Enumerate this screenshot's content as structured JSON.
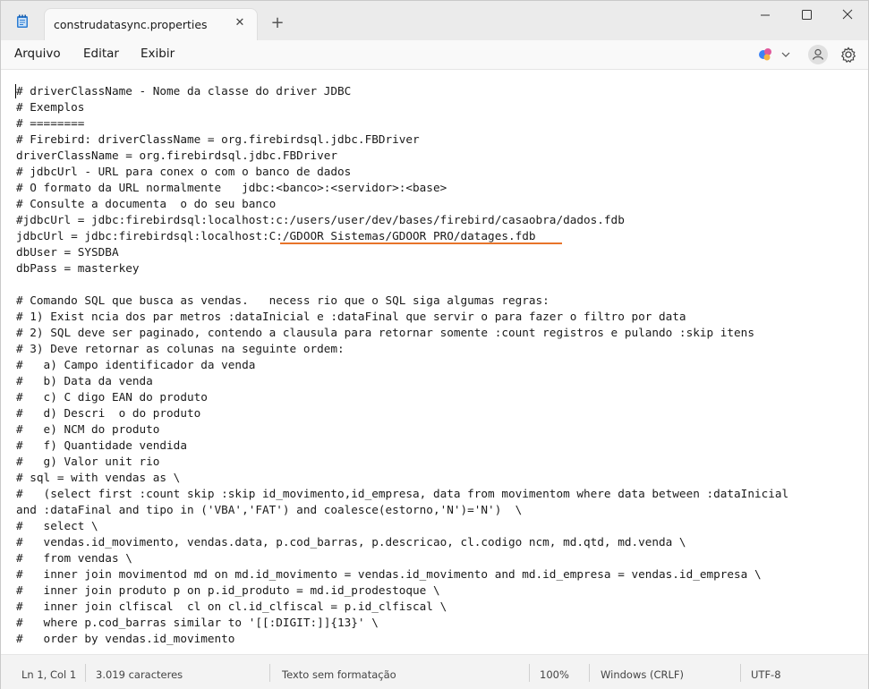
{
  "tab": {
    "title": "construdatasync.properties"
  },
  "menu": {
    "items": [
      "Arquivo",
      "Editar",
      "Exibir"
    ]
  },
  "colors": {
    "highlight": "#e8742a",
    "copilot_blue": "#3b82f6",
    "copilot_pink": "#e0589b"
  },
  "icons": {
    "app": "notepad-icon",
    "copilot": "copilot-icon",
    "profile": "person-icon",
    "settings": "gear-icon"
  },
  "editor": {
    "lines": [
      "# driverClassName - Nome da classe do driver JDBC",
      "# Exemplos",
      "# ========",
      "# Firebird: driverClassName = org.firebirdsql.jdbc.FBDriver",
      "driverClassName = org.firebirdsql.jdbc.FBDriver",
      "# jdbcUrl - URL para conex o com o banco de dados",
      "# O formato da URL normalmente   jdbc:<banco>:<servidor>:<base>",
      "# Consulte a documenta  o do seu banco",
      "#jdbcUrl = jdbc:firebirdsql:localhost:c:/users/user/dev/bases/firebird/casaobra/dados.fdb",
      "jdbcUrl = jdbc:firebirdsql:localhost:C:/GDOOR Sistemas/GDOOR PRO/datages.fdb",
      "dbUser = SYSDBA",
      "dbPass = masterkey",
      "",
      "# Comando SQL que busca as vendas.   necess rio que o SQL siga algumas regras:",
      "# 1) Exist ncia dos par metros :dataInicial e :dataFinal que servir o para fazer o filtro por data",
      "# 2) SQL deve ser paginado, contendo a clausula para retornar somente :count registros e pulando :skip itens",
      "# 3) Deve retornar as colunas na seguinte ordem:",
      "#   a) Campo identificador da venda",
      "#   b) Data da venda",
      "#   c) C digo EAN do produto",
      "#   d) Descri  o do produto",
      "#   e) NCM do produto",
      "#   f) Quantidade vendida",
      "#   g) Valor unit rio",
      "# sql = with vendas as \\",
      "#   (select first :count skip :skip id_movimento,id_empresa, data from movimentom where data between :dataInicial",
      "and :dataFinal and tipo in ('VBA','FAT') and coalesce(estorno,'N')='N')  \\",
      "#   select \\",
      "#   vendas.id_movimento, vendas.data, p.cod_barras, p.descricao, cl.codigo ncm, md.qtd, md.venda \\",
      "#   from vendas \\",
      "#   inner join movimentod md on md.id_movimento = vendas.id_movimento and md.id_empresa = vendas.id_empresa \\",
      "#   inner join produto p on p.id_produto = md.id_prodestoque \\",
      "#   inner join clfiscal  cl on cl.id_clfiscal = p.id_clfiscal \\",
      "#   where p.cod_barras similar to '[[:DIGIT:]]{13}' \\",
      "#   order by vendas.id_movimento"
    ]
  },
  "status": {
    "position": "Ln 1, Col 1",
    "chars": "3.019 caracteres",
    "format": "Texto sem formatação",
    "zoom": "100%",
    "line_ending": "Windows (CRLF)",
    "encoding": "UTF-8"
  }
}
